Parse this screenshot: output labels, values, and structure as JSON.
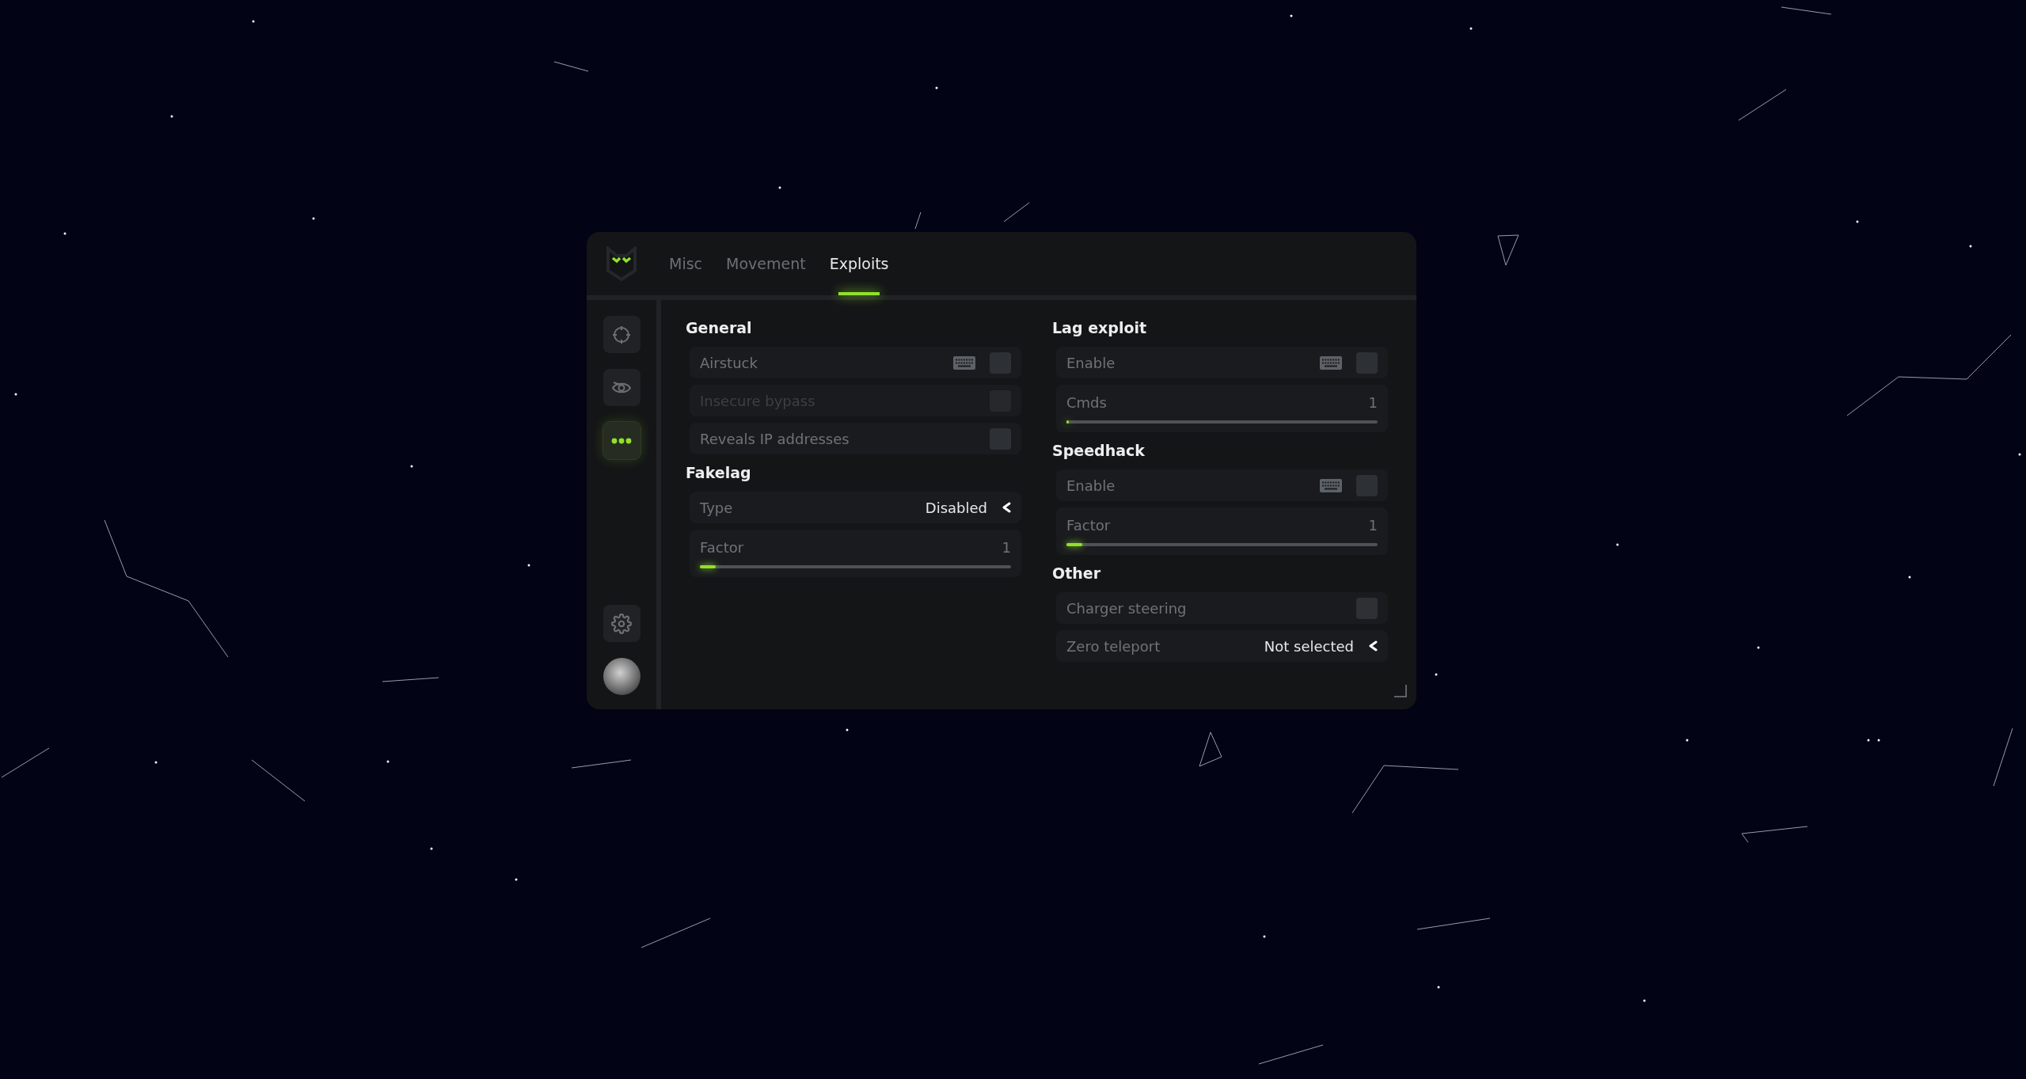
{
  "tabs": [
    {
      "label": "Misc",
      "selected": false
    },
    {
      "label": "Movement",
      "selected": false
    },
    {
      "label": "Exploits",
      "selected": true
    }
  ],
  "sidebar": {
    "items": [
      {
        "kind": "crosshair",
        "selected": false
      },
      {
        "kind": "eye",
        "selected": false
      },
      {
        "kind": "dots",
        "selected": true
      }
    ],
    "bottom": [
      {
        "kind": "settings",
        "selected": false
      }
    ]
  },
  "columns": [
    [
      {
        "title": "General",
        "items": [
          {
            "kind": "toggle",
            "label": "Airstuck",
            "checked": false,
            "disabled": false,
            "keybind": true
          },
          {
            "kind": "toggle",
            "label": "Insecure bypass",
            "checked": false,
            "disabled": true,
            "keybind": false
          },
          {
            "kind": "toggle",
            "label": "Reveals IP addresses",
            "checked": false,
            "disabled": false,
            "keybind": false
          }
        ]
      },
      {
        "title": "Fakelag",
        "items": [
          {
            "kind": "select",
            "label": "Type",
            "value": "Disabled"
          },
          {
            "kind": "slider",
            "label": "Factor",
            "reading": "1",
            "level": 0.05
          }
        ]
      }
    ],
    [
      {
        "title": "Lag exploit",
        "items": [
          {
            "kind": "toggle",
            "label": "Enable",
            "checked": false,
            "disabled": false,
            "keybind": true
          },
          {
            "kind": "slider",
            "label": "Cmds",
            "reading": "1",
            "level": 0.005
          }
        ]
      },
      {
        "title": "Speedhack",
        "items": [
          {
            "kind": "toggle",
            "label": "Enable",
            "checked": false,
            "disabled": false,
            "keybind": true
          },
          {
            "kind": "slider",
            "label": "Factor",
            "reading": "1",
            "level": 0.05
          }
        ]
      },
      {
        "title": "Other",
        "items": [
          {
            "kind": "toggle",
            "label": "Charger steering",
            "checked": false,
            "disabled": false,
            "keybind": false
          },
          {
            "kind": "select",
            "label": "Zero teleport",
            "value": "Not selected"
          }
        ]
      }
    ]
  ]
}
